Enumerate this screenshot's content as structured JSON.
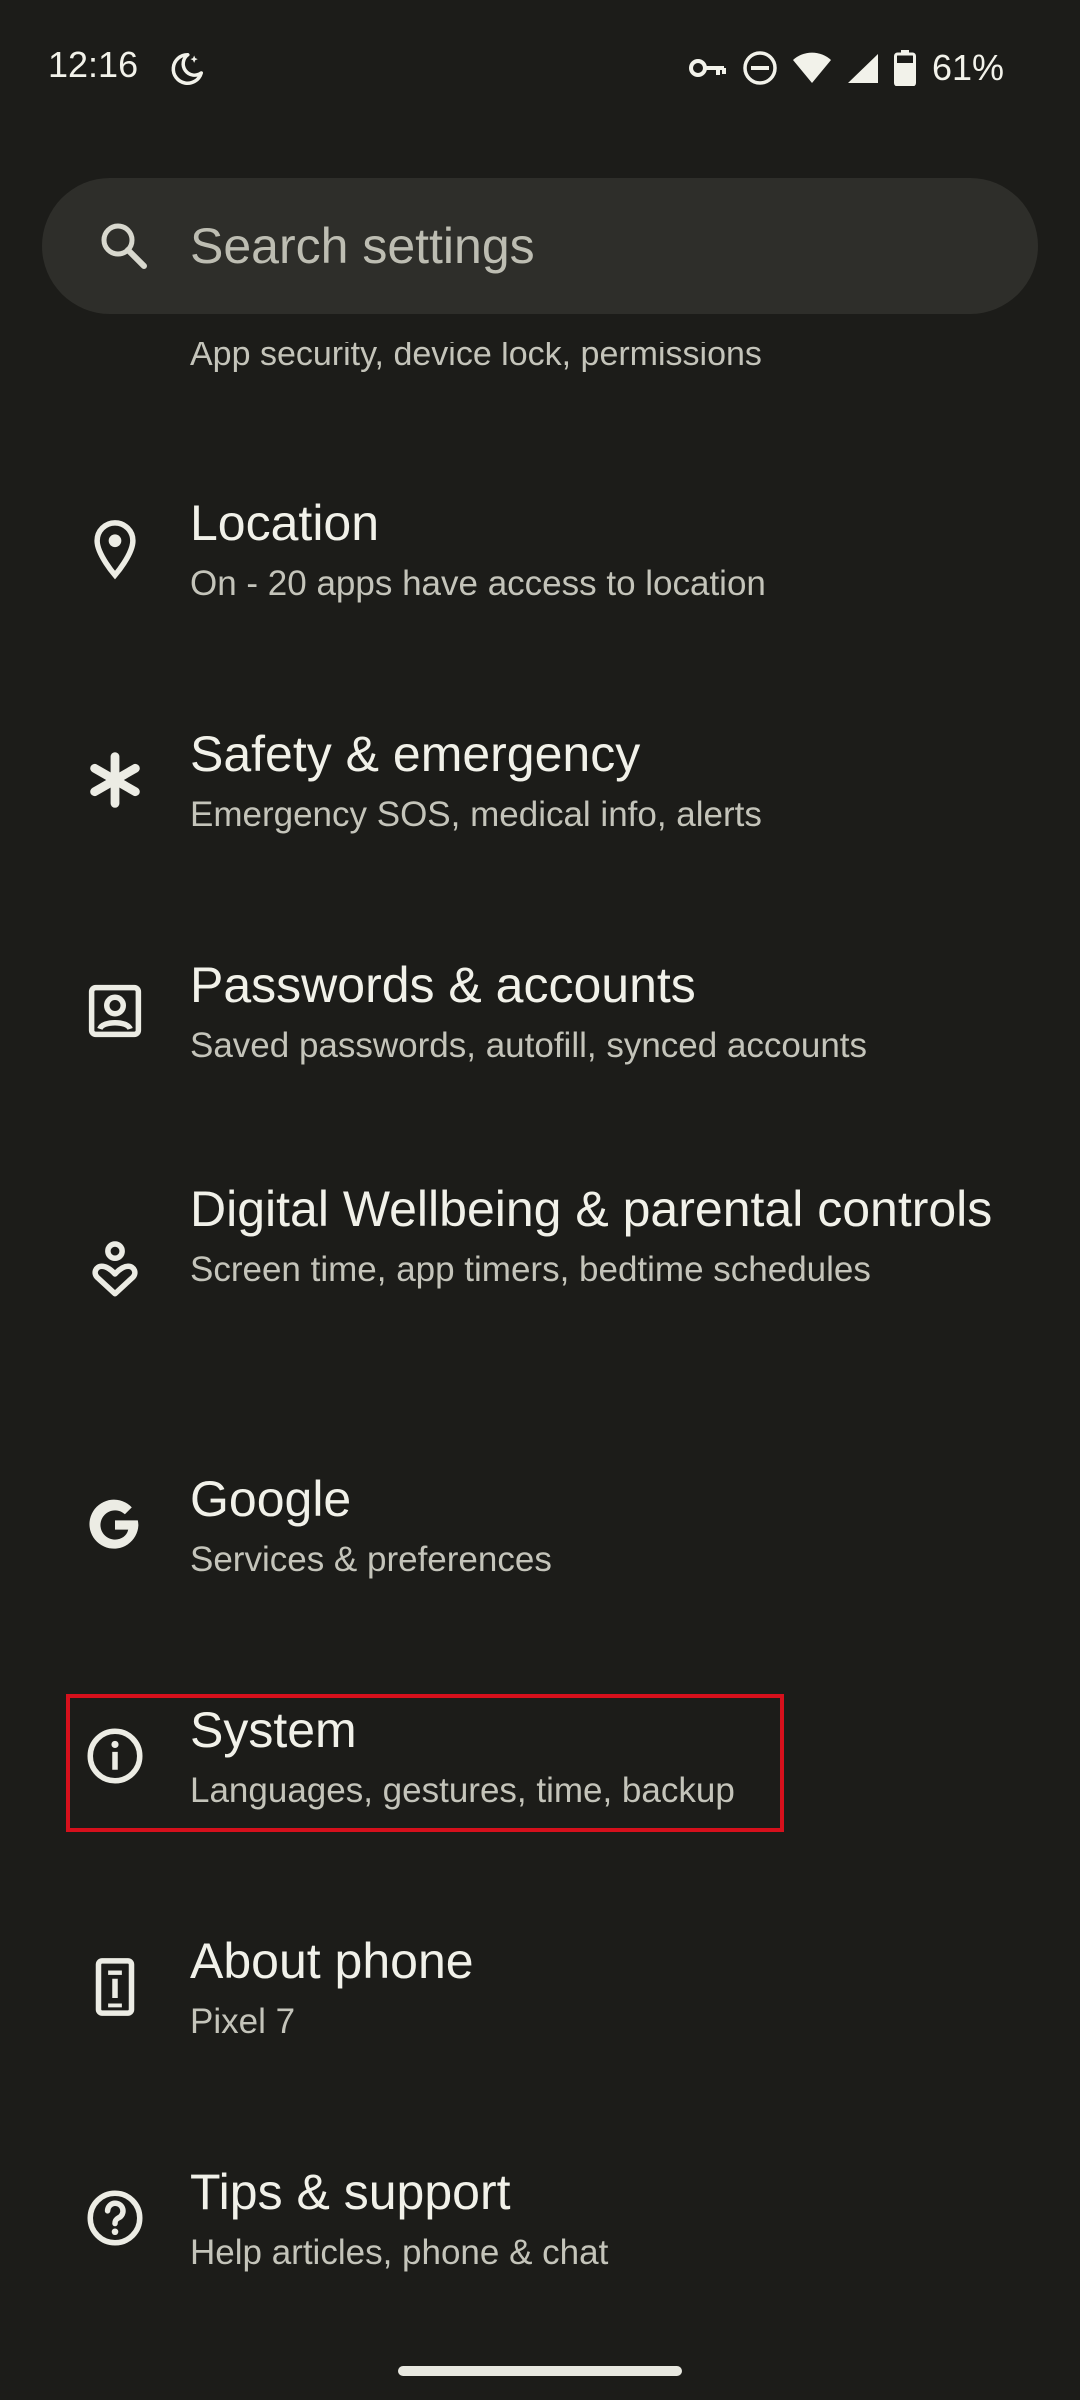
{
  "status_bar": {
    "time": "12:16",
    "battery_percent": "61%",
    "icons": [
      "bedtime-moon-icon",
      "vpn-key-icon",
      "do-not-disturb-icon",
      "wifi-icon",
      "signal-icon",
      "battery-icon"
    ]
  },
  "search": {
    "placeholder": "Search settings"
  },
  "partial_item": {
    "subtitle": "App security, device lock, permissions"
  },
  "items": [
    {
      "title": "Location",
      "subtitle": "On - 20 apps have access to location",
      "icon": "location-pin-icon"
    },
    {
      "title": "Safety & emergency",
      "subtitle": "Emergency SOS, medical info, alerts",
      "icon": "asterisk-icon"
    },
    {
      "title": "Passwords & accounts",
      "subtitle": "Saved passwords, autofill, synced accounts",
      "icon": "account-box-icon"
    },
    {
      "title": "Digital Wellbeing & parental controls",
      "subtitle": "Screen time, app timers, bedtime schedules",
      "icon": "wellbeing-icon"
    },
    {
      "title": "Google",
      "subtitle": "Services & preferences",
      "icon": "google-g-icon"
    },
    {
      "title": "System",
      "subtitle": "Languages, gestures, time, backup",
      "icon": "info-icon"
    },
    {
      "title": "About phone",
      "subtitle": "Pixel 7",
      "icon": "phone-info-icon"
    },
    {
      "title": "Tips & support",
      "subtitle": "Help articles, phone & chat",
      "icon": "help-icon"
    }
  ],
  "colors": {
    "background": "#1c1c19",
    "search_bg": "#2e2e2a",
    "highlight_border": "#d6101c"
  }
}
